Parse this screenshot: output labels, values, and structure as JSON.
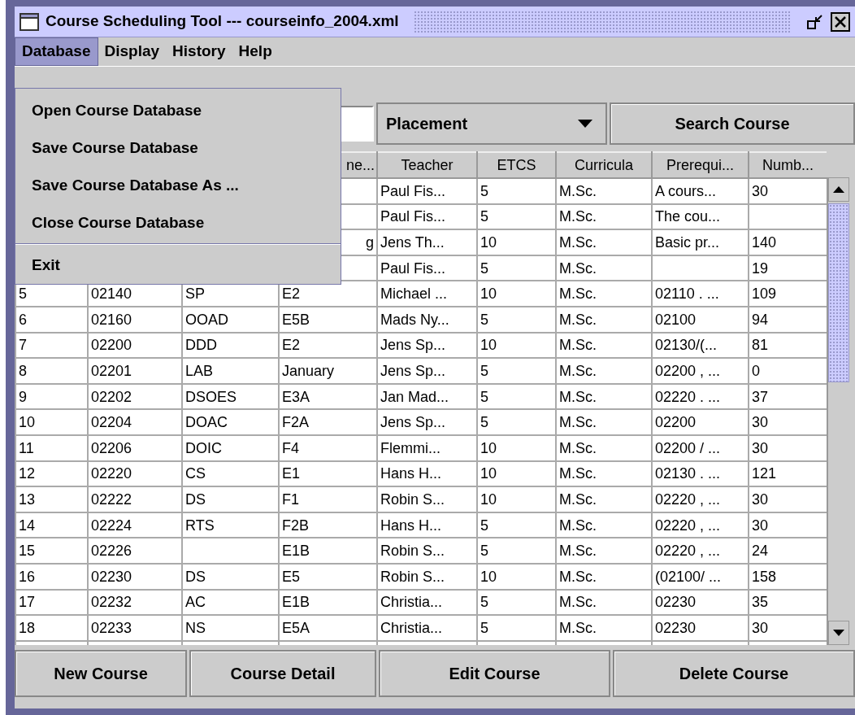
{
  "window": {
    "title": "Course Scheduling Tool --- courseinfo_2004.xml"
  },
  "menu_bar": [
    {
      "label": "Database",
      "selected": true
    },
    {
      "label": "Display",
      "selected": false
    },
    {
      "label": "History",
      "selected": false
    },
    {
      "label": "Help",
      "selected": false
    }
  ],
  "open_menu": {
    "items": [
      {
        "kind": "item",
        "label": "Open Course Database"
      },
      {
        "kind": "item",
        "label": "Save Course Database"
      },
      {
        "kind": "item",
        "label": "Save Course Database As ..."
      },
      {
        "kind": "item",
        "label": "Close Course Database"
      },
      {
        "kind": "separator"
      },
      {
        "kind": "item",
        "label": "Exit"
      }
    ]
  },
  "toolbar": {
    "filter_combo": {
      "value": "Placement"
    },
    "search_button": "Search Course"
  },
  "table": {
    "columns": [
      null,
      null,
      null,
      {
        "text": "ne...",
        "cut_left": true
      },
      "Teacher",
      "ETCS",
      "Curricula",
      "Prerequi...",
      "Numb..."
    ],
    "rows": [
      [
        null,
        null,
        null,
        null,
        "Paul Fis...",
        "5",
        "M.Sc.",
        "A cours...",
        "30"
      ],
      [
        null,
        null,
        null,
        null,
        "Paul Fis...",
        "5",
        "M.Sc.",
        "The cou...",
        null
      ],
      [
        null,
        null,
        null,
        {
          "text": "g",
          "cut_left": true
        },
        "Jens Th...",
        "10",
        "M.Sc.",
        "Basic pr...",
        "140"
      ],
      [
        null,
        null,
        null,
        null,
        "Paul Fis...",
        "5",
        "M.Sc.",
        null,
        "19"
      ],
      [
        "5",
        "02140",
        "SP",
        "E2",
        "Michael ...",
        "10",
        "M.Sc.",
        "02110 . ...",
        "109"
      ],
      [
        "6",
        "02160",
        "OOAD",
        "E5B",
        "Mads Ny...",
        "5",
        "M.Sc.",
        "02100",
        "94"
      ],
      [
        "7",
        "02200",
        "DDD",
        "E2",
        "Jens Sp...",
        "10",
        "M.Sc.",
        "02130/(...",
        "81"
      ],
      [
        "8",
        "02201",
        "LAB",
        "January",
        "Jens Sp...",
        "5",
        "M.Sc.",
        "02200 , ...",
        "0"
      ],
      [
        "9",
        "02202",
        "DSOES",
        "E3A",
        "Jan Mad...",
        "5",
        "M.Sc.",
        "02220 . ...",
        "37"
      ],
      [
        "10",
        "02204",
        "DOAC",
        "F2A",
        "Jens Sp...",
        "5",
        "M.Sc.",
        "02200",
        "30"
      ],
      [
        "11",
        "02206",
        "DOIC",
        "F4",
        "Flemmi...",
        "10",
        "M.Sc.",
        "02200  / ...",
        "30"
      ],
      [
        "12",
        "02220",
        "CS",
        "E1",
        "Hans H...",
        "10",
        "M.Sc.",
        "02130 . ...",
        "121"
      ],
      [
        "13",
        "02222",
        "DS",
        "F1",
        "Robin S...",
        "10",
        "M.Sc.",
        "02220 , ...",
        "30"
      ],
      [
        "14",
        "02224",
        "RTS",
        "F2B",
        "Hans H...",
        "5",
        "M.Sc.",
        "02220 , ...",
        "30"
      ],
      [
        "15",
        "02226",
        null,
        "E1B",
        "Robin S...",
        "5",
        "M.Sc.",
        "02220 , ...",
        "24"
      ],
      [
        "16",
        "02230",
        "DS",
        "E5",
        "Robin S...",
        "10",
        "M.Sc.",
        "(02100/ ...",
        "158"
      ],
      [
        "17",
        "02232",
        "AC",
        "E1B",
        "Christia...",
        "5",
        "M.Sc.",
        "02230",
        "35"
      ],
      [
        "18",
        "02233",
        "NS",
        "E5A",
        "Christia...",
        "5",
        "M.Sc.",
        "02230",
        "30"
      ]
    ]
  },
  "buttons": [
    "New Course",
    "Course Detail",
    "Edit Course",
    "Delete Course"
  ]
}
